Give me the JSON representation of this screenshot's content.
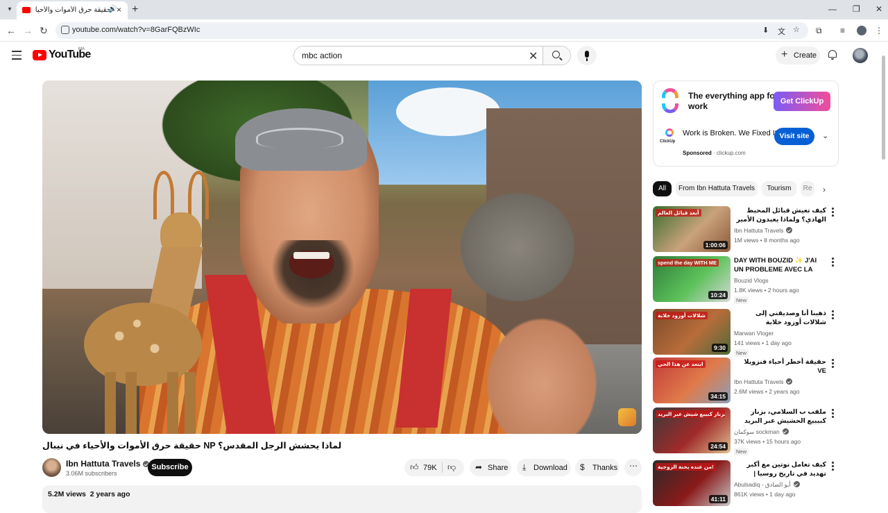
{
  "browser": {
    "tab_title": "حقيقة حرق الأموات والأحياء ف...",
    "url": "youtube.com/watch?v=8GarFQBzWIc",
    "icons": [
      "tab-list-icon",
      "audio-icon",
      "close-icon",
      "new-tab-icon",
      "minimize-icon",
      "restore-icon",
      "close-window-icon",
      "back-icon",
      "forward-icon",
      "reload-icon",
      "site-info-icon",
      "install-icon",
      "translate-icon",
      "bookmark-star-icon",
      "extensions-icon",
      "media-icon",
      "profile-icon",
      "menu-kebab-icon"
    ]
  },
  "header": {
    "logo_text": "YouTube",
    "country_code": "MA",
    "search_value": "mbc action",
    "create_label": "Create"
  },
  "video": {
    "title": "لماذا يحشش الرجل المقدس؟ NP حقيقة حرق الأموات والأحياء في نيبال",
    "channel": "Ibn Hattuta Travels",
    "subscribers": "3.06M subscribers",
    "subscribe_label": "Subscribe",
    "likes": "79K",
    "share_label": "Share",
    "download_label": "Download",
    "thanks_label": "Thanks",
    "views": "5.2M views",
    "age": "2 years ago"
  },
  "ad": {
    "banner_tagline": "The everything app for work",
    "banner_button": "Get ClickUp",
    "brand_small": "ClickUp",
    "headline": "Work is Broken. We Fixed It",
    "sponsored": "Sponsored",
    "domain": "· clickup.com",
    "visit_label": "Visit site"
  },
  "chips": [
    "All",
    "From Ibn Hattuta Travels",
    "Tourism",
    "Re"
  ],
  "recommendations": [
    {
      "title": "كيف تعيش قبائل المحيط الهادي؟ ولماذا يعبدون الأمير فيليب؟ | وثائقي دولة فانواتو",
      "channel": "Ibn Hattuta Travels",
      "verified": true,
      "views": "1M views • 8 months ago",
      "duration": "1:00:06",
      "badge": "",
      "rtl": true,
      "thumb_overlay": "أبعد قبائل العالم",
      "colors": [
        "#3a6d2f",
        "#c9a27a",
        "#8a5a3a"
      ]
    },
    {
      "title": "DAY WITH BOUZID ✨ J'AI UN PROBLEME AVEC LA BMW 🚗 ...",
      "channel": "Bouzid Vlogs",
      "verified": false,
      "views": "1.8K views • 2 hours ago",
      "duration": "10:24",
      "badge": "New",
      "rtl": false,
      "thumb_overlay": "spend the day WITH ME",
      "colors": [
        "#2f7a3a",
        "#5cc25a",
        "#d8d8d8"
      ]
    },
    {
      "title": "ذهبنا أنا وصديقتي إلى شلالات أوزود خلابة",
      "channel": "Marwan Vloger",
      "verified": false,
      "views": "141 views • 1 day ago",
      "duration": "9:30",
      "badge": "New",
      "rtl": true,
      "thumb_overlay": "شلالات أوزود خلابة",
      "colors": [
        "#7a4a2a",
        "#b86c3a",
        "#4d6a3a"
      ]
    },
    {
      "title": "حقيقة أخطر أحياء فنزويلا VE",
      "channel": "Ibn Hattuta Travels",
      "verified": true,
      "views": "2.6M views • 2 years ago",
      "duration": "34:15",
      "badge": "",
      "rtl": true,
      "thumb_overlay": "ابتعد عن هذا الحي",
      "colors": [
        "#c23a3a",
        "#e07a4a",
        "#8aa0b8"
      ]
    },
    {
      "title": "ملقب ب السلامي، بزناز كبيييع الحشيش عبر البريد (قصة مغربية خطيرة) ❌ 🔥",
      "channel": "سوكمان sockman",
      "verified": true,
      "views": "37K views • 15 hours ago",
      "duration": "24:54",
      "badge": "New",
      "rtl": true,
      "thumb_overlay": "بزناز كبيبع شيش عبر البريد",
      "colors": [
        "#3a3a3a",
        "#a02a2a",
        "#e0c090"
      ]
    },
    {
      "title": "كيف تعامل نوتين مع أكبر تهديد في تاريخ روسيا | المجموعة الشيشانية",
      "channel": "Abulsadiq - أبو الصادق",
      "verified": true,
      "views": "861K views • 1 day ago",
      "duration": "41:11",
      "badge": "",
      "rtl": true,
      "thumb_overlay": "من عنده يحنة الزوجية!",
      "colors": [
        "#2a2a2a",
        "#8a1a1a",
        "#c8c8c8"
      ]
    }
  ],
  "colors": {
    "youtube_red": "#ff0000",
    "visit_blue": "#065fd4",
    "subscribe_bg": "#0f0f0f"
  }
}
